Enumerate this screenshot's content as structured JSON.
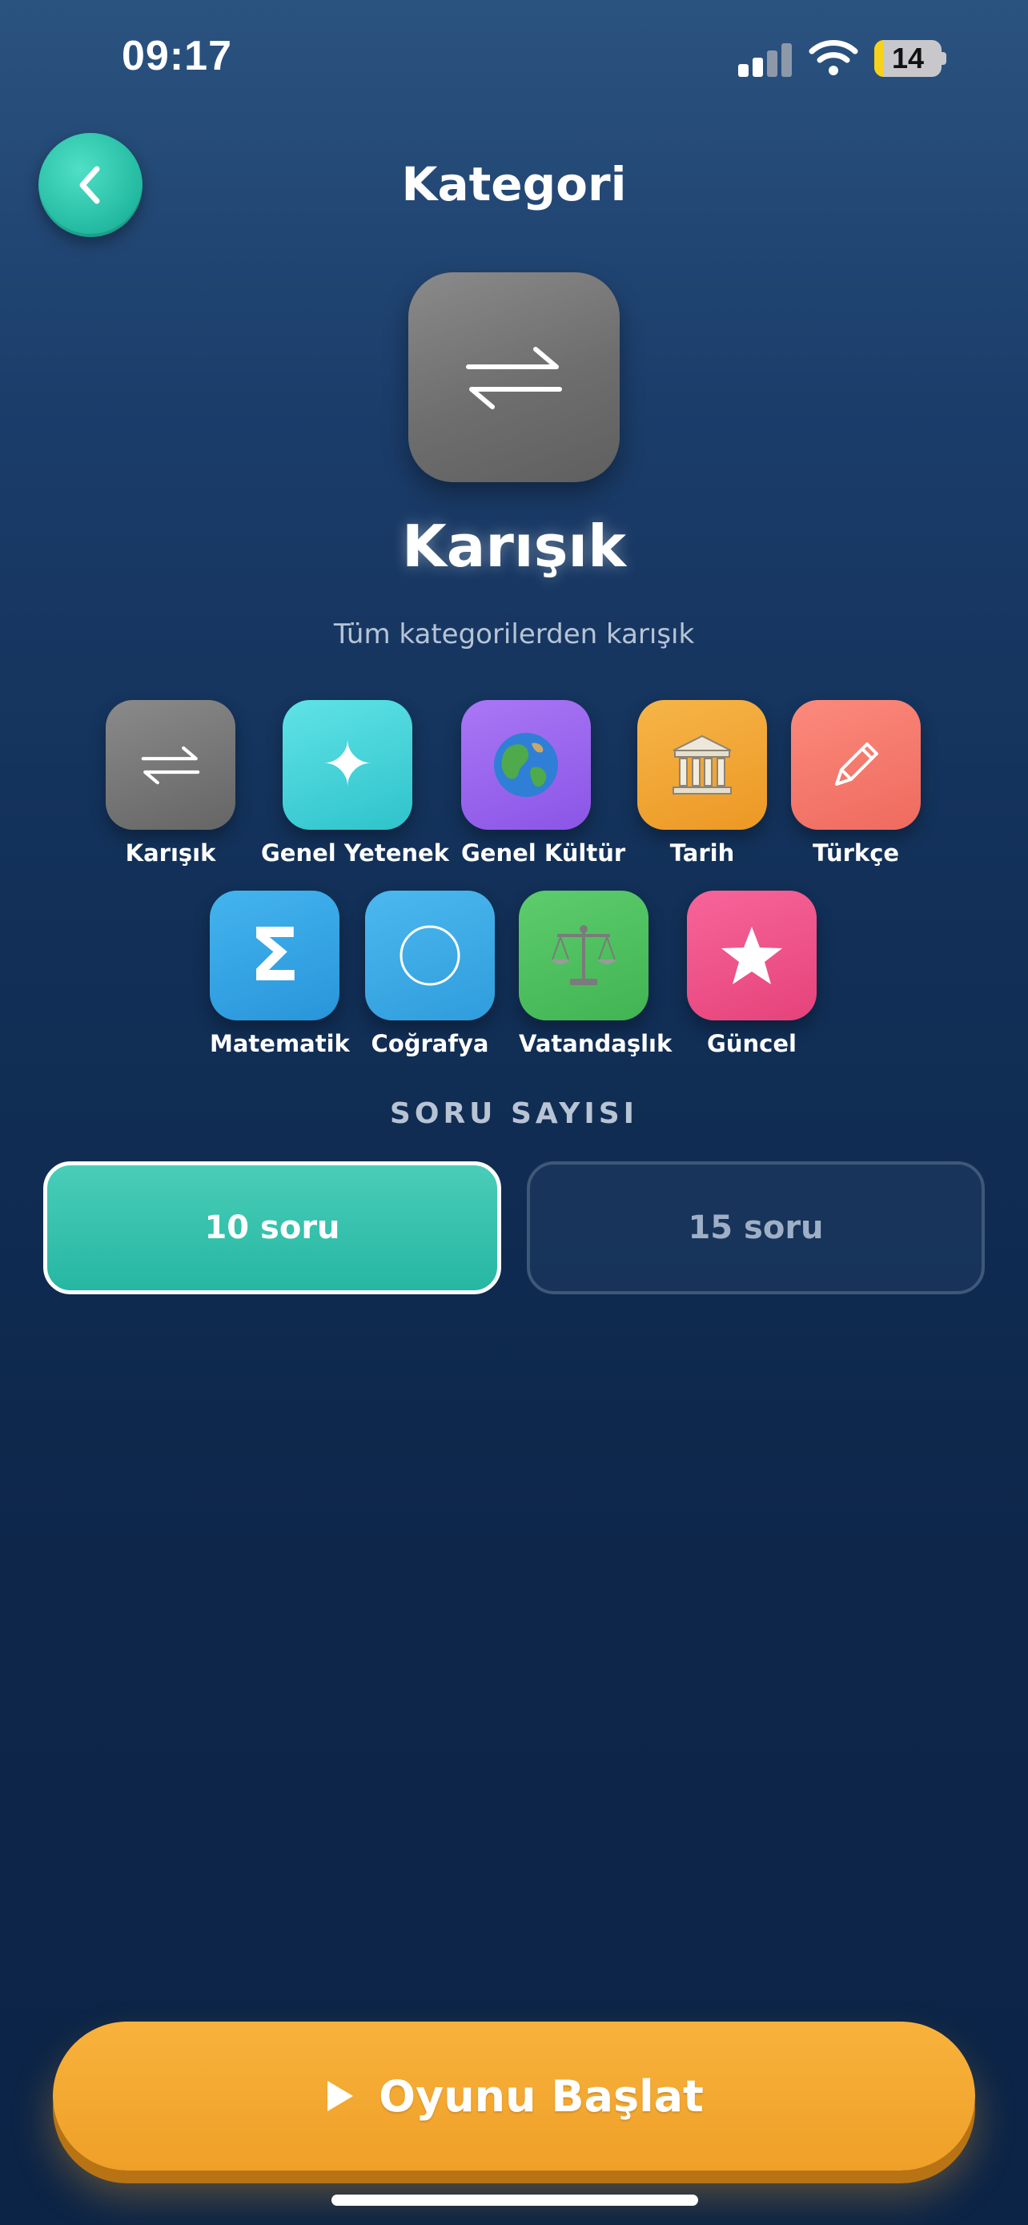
{
  "status_bar": {
    "time": "09:17",
    "battery_level": "14",
    "battery_fraction": 0.14
  },
  "header": {
    "title": "Kategori",
    "back_icon": "chevron-left-icon"
  },
  "selected_category": {
    "name": "Karışık",
    "description": "Tüm kategorilerden karışık",
    "icon": "swap-arrows-icon"
  },
  "categories": [
    {
      "label": "Karışık",
      "icon": "swap-arrows-icon",
      "color": "#7a7a7a",
      "glyph": ""
    },
    {
      "label": "Genel Yetenek",
      "icon": "sparkle-icon",
      "color": "#3ed3d9",
      "glyph": "✦"
    },
    {
      "label": "Genel Kültür",
      "icon": "globe-icon",
      "color": "#9b63f0",
      "glyph": "🌍"
    },
    {
      "label": "Tarih",
      "icon": "classical-building-icon",
      "color": "#f0a332",
      "glyph": "🏛"
    },
    {
      "label": "Türkçe",
      "icon": "pencil-icon",
      "color": "#f5776a",
      "glyph": "✎"
    },
    {
      "label": "Matematik",
      "icon": "sigma-icon",
      "color": "#2f9fe0",
      "glyph": "Σ"
    },
    {
      "label": "Coğrafya",
      "icon": "circle-icon",
      "color": "#3aa8e2",
      "glyph": "◯"
    },
    {
      "label": "Vatandaşlık",
      "icon": "scales-icon",
      "color": "#4cbf5c",
      "glyph": "⚖"
    },
    {
      "label": "Güncel",
      "icon": "star-icon",
      "color": "#ef4f86",
      "glyph": "★"
    }
  ],
  "question_count": {
    "title": "SORU SAYISI",
    "options": [
      {
        "label": "10 soru",
        "selected": true
      },
      {
        "label": "15 soru",
        "selected": false
      }
    ]
  },
  "start_button": {
    "label": "Oyunu Başlat",
    "icon": "play-icon"
  },
  "colors": {
    "accent_teal": "#26b7a2",
    "start_orange": "#f2a42c"
  }
}
